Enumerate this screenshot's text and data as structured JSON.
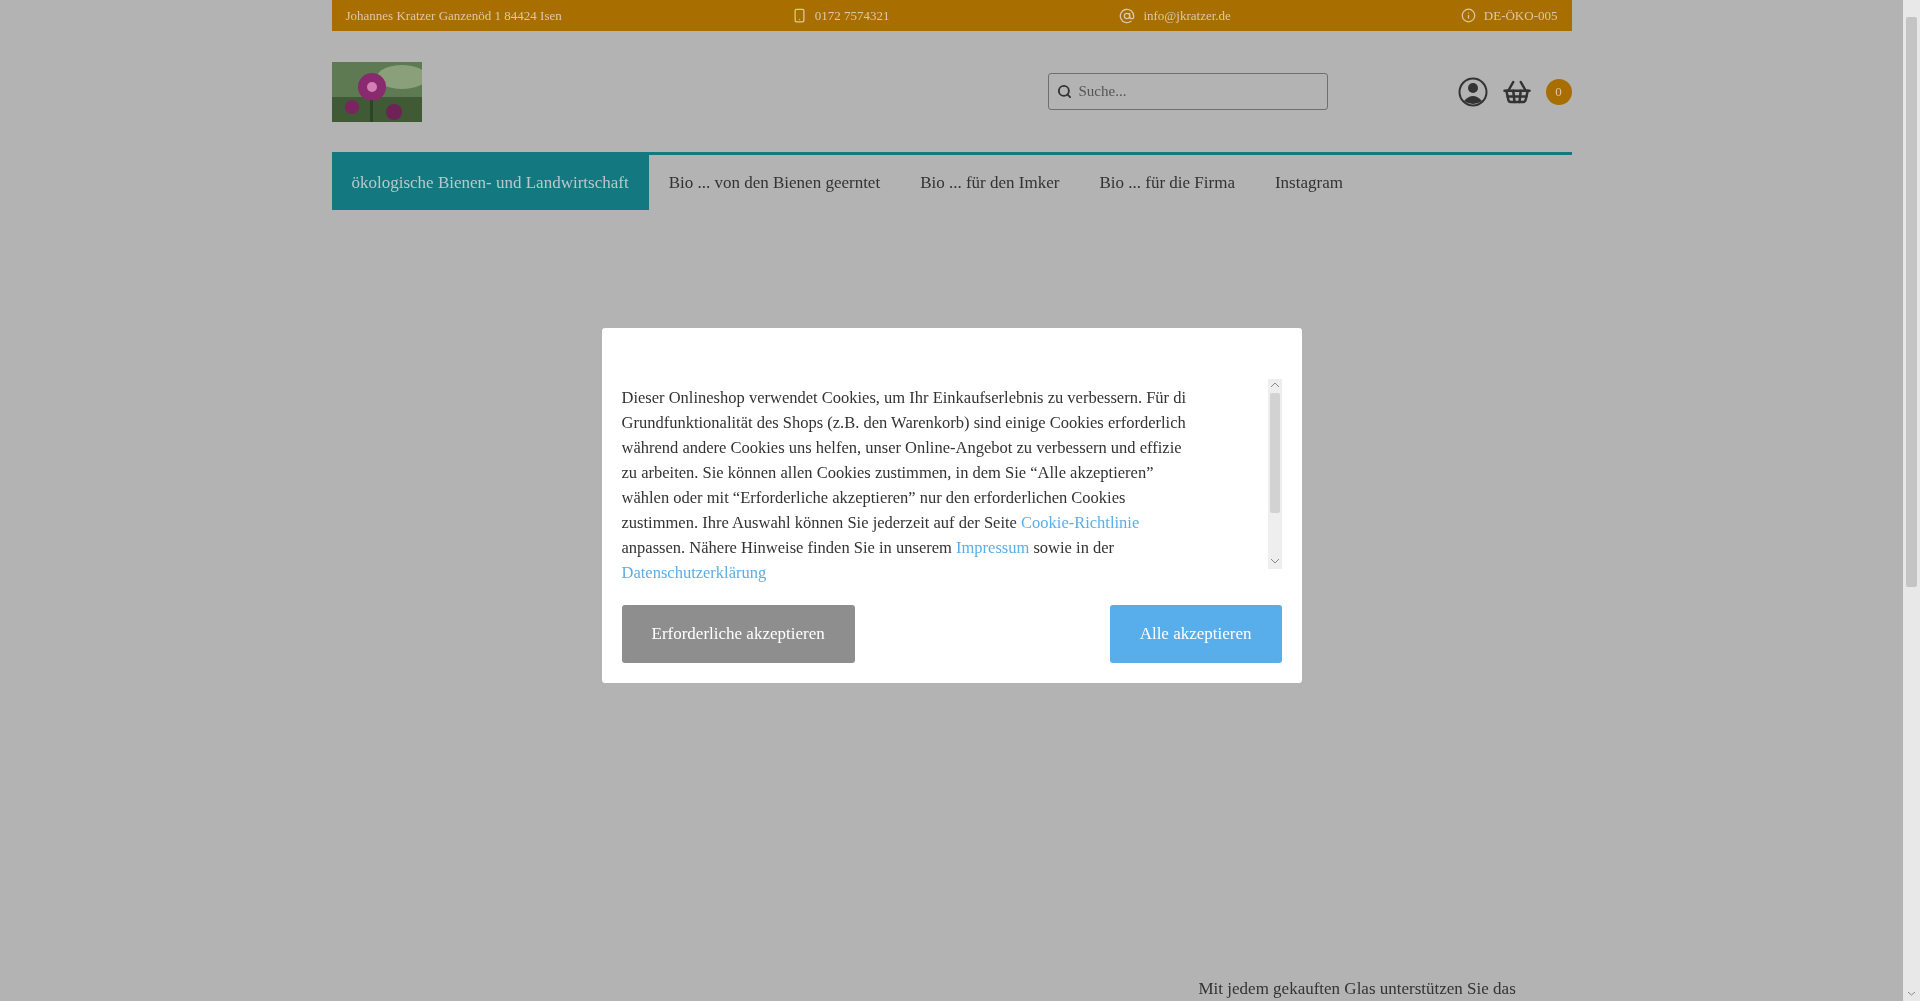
{
  "topbar": {
    "address": "Johannes Kratzer Ganzenöd 1 84424 Isen",
    "phone": "0172 7574321",
    "email": "info@jkratzer.de",
    "certificate": "DE-ÖKO-005"
  },
  "header": {
    "search": {
      "placeholder": "Suche..."
    },
    "cart_count": "0"
  },
  "nav": [
    {
      "label": "ökologische Bienen- und Landwirtschaft",
      "selected": true
    },
    {
      "label": "Bio ... von den Bienen geerntet",
      "selected": false
    },
    {
      "label": "Bio ... für den Imker",
      "selected": false
    },
    {
      "label": "Bio ... für die Firma",
      "selected": false
    },
    {
      "label": "Instagram",
      "selected": false
    }
  ],
  "cookie_dialog": {
    "lines": [
      [
        {
          "text": "Dieser Onlineshop verwendet Cookies, um Ihr Einkaufserlebnis zu verbessern. Für di",
          "link": false
        }
      ],
      [
        {
          "text": "Grundfunktionalität des Shops (z.B. den Warenkorb) sind einige Cookies erforderlich",
          "link": false
        }
      ],
      [
        {
          "text": "während andere Cookies uns helfen, unser Online-Angebot zu verbessern und effizie",
          "link": false
        }
      ],
      [
        {
          "text": "zu arbeiten. Sie können allen Cookies zustimmen, in dem Sie “Alle akzeptieren”",
          "link": false
        }
      ],
      [
        {
          "text": "wählen oder mit “Erforderliche akzeptieren” nur den erforderlichen Cookies",
          "link": false
        }
      ],
      [
        {
          "text": "zustimmen. Ihre Auswahl können Sie jederzeit auf der Seite ",
          "link": false
        },
        {
          "text": "Cookie-Richtlinie",
          "link": true
        }
      ],
      [
        {
          "text": "anpassen. Nähere Hinweise finden Sie in unserem ",
          "link": false
        },
        {
          "text": "Impressum",
          "link": true
        },
        {
          "text": " sowie in der",
          "link": false
        }
      ],
      [
        {
          "text": "Datenschutzerklärung",
          "link": true
        }
      ]
    ],
    "buttons": [
      {
        "label": "Erforderliche akzeptieren",
        "kind": "secondary"
      },
      {
        "label": "Alle akzeptieren",
        "kind": "primary"
      }
    ]
  },
  "teaser": "Mit jedem gekauften Glas unterstützen Sie das"
}
